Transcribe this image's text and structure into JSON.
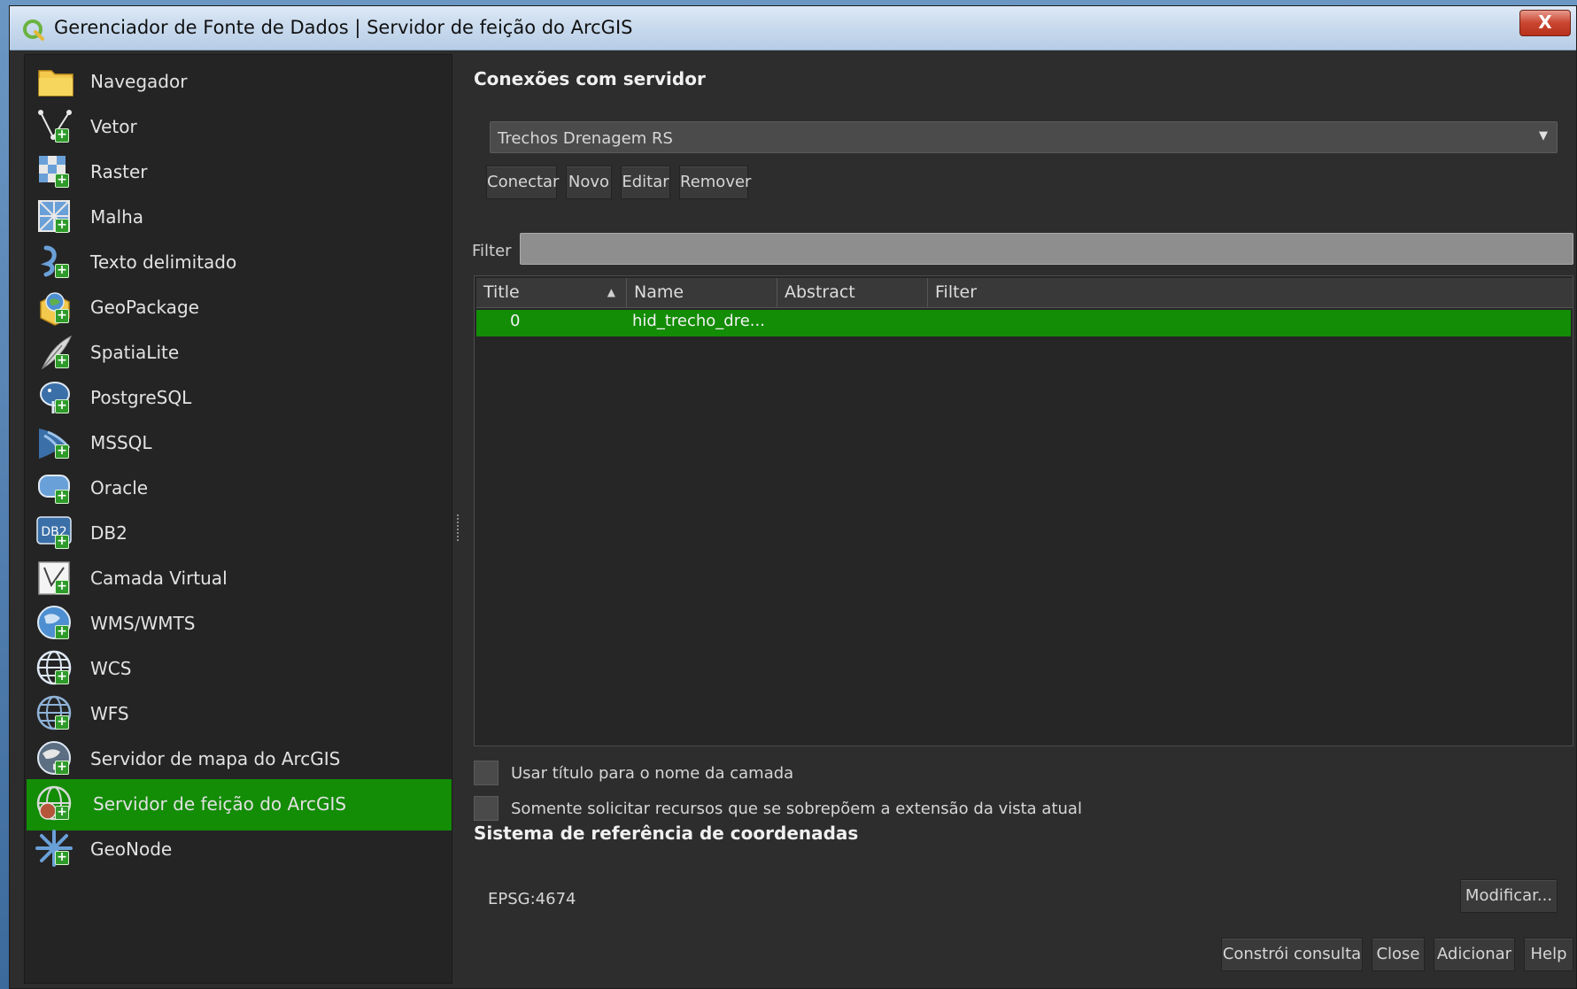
{
  "window": {
    "title": "Gerenciador de Fonte de Dados | Servidor de feição do ArcGIS",
    "close_label": "X"
  },
  "sidebar": {
    "items": [
      {
        "label": "Navegador",
        "icon": "folder-icon"
      },
      {
        "label": "Vetor",
        "icon": "vector-icon"
      },
      {
        "label": "Raster",
        "icon": "raster-icon"
      },
      {
        "label": "Malha",
        "icon": "mesh-icon"
      },
      {
        "label": "Texto delimitado",
        "icon": "delimited-text-icon"
      },
      {
        "label": "GeoPackage",
        "icon": "geopackage-icon"
      },
      {
        "label": "SpatiaLite",
        "icon": "spatialite-icon"
      },
      {
        "label": "PostgreSQL",
        "icon": "postgresql-icon"
      },
      {
        "label": "MSSQL",
        "icon": "mssql-icon"
      },
      {
        "label": "Oracle",
        "icon": "oracle-icon"
      },
      {
        "label": "DB2",
        "icon": "db2-icon"
      },
      {
        "label": "Camada Virtual",
        "icon": "virtual-layer-icon"
      },
      {
        "label": "WMS/WMTS",
        "icon": "wms-icon"
      },
      {
        "label": "WCS",
        "icon": "wcs-icon"
      },
      {
        "label": "WFS",
        "icon": "wfs-icon"
      },
      {
        "label": "Servidor de mapa do ArcGIS",
        "icon": "arcgis-map-server-icon"
      },
      {
        "label": "Servidor de feição do ArcGIS",
        "icon": "arcgis-feature-server-icon",
        "selected": true
      },
      {
        "label": "GeoNode",
        "icon": "geonode-icon"
      }
    ]
  },
  "connections": {
    "heading": "Conexões com servidor",
    "selected_connection": "Trechos Drenagem RS",
    "buttons": {
      "connect": "Conectar",
      "new": "Novo",
      "edit": "Editar",
      "remove": "Remover"
    }
  },
  "filter": {
    "label": "Filter",
    "value": ""
  },
  "table": {
    "columns": [
      "Title",
      "Name",
      "Abstract",
      "Filter"
    ],
    "sort_indicator": "▲",
    "rows": [
      {
        "title": "0",
        "name": "hid_trecho_dre...",
        "abstract": "",
        "filter": ""
      }
    ]
  },
  "options": {
    "use_title": "Usar título para o nome da camada",
    "only_extent": "Somente solicitar recursos que se sobrepõem a extensão da vista atual"
  },
  "crs": {
    "heading": "Sistema de referência de coordenadas",
    "value": "EPSG:4674",
    "modify_label": "Modificar..."
  },
  "footer": {
    "build_query": "Constrói consulta",
    "close": "Close",
    "add": "Adicionar",
    "help": "Help"
  },
  "colors": {
    "selection_green": "#138c06",
    "background": "#2d2d2d"
  }
}
